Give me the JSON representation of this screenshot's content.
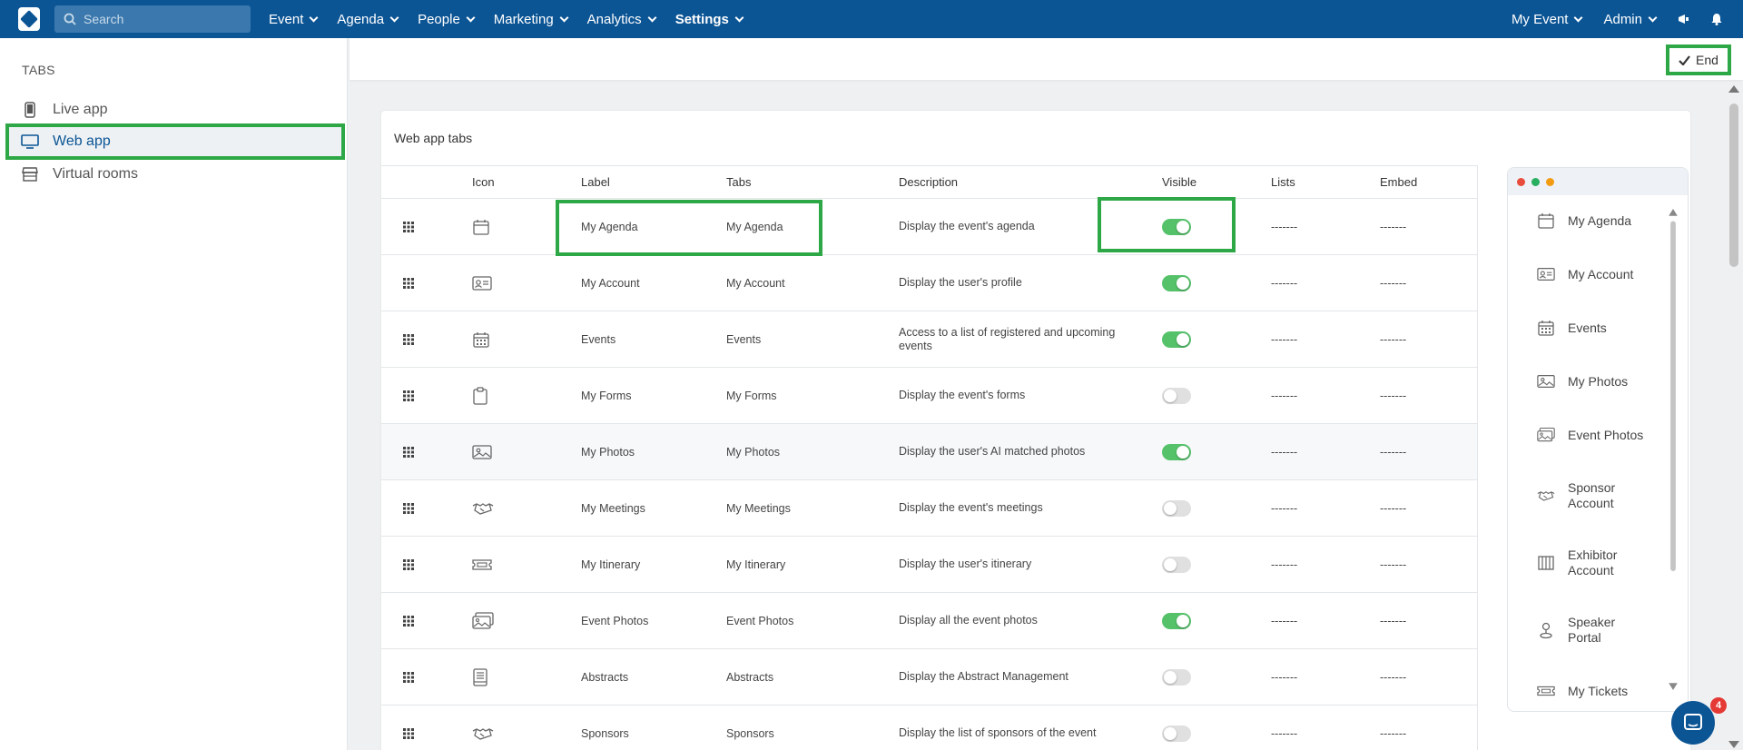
{
  "topbar": {
    "search_placeholder": "Search",
    "nav": [
      "Event",
      "Agenda",
      "People",
      "Marketing",
      "Analytics",
      "Settings"
    ],
    "right": [
      "My Event",
      "Admin"
    ],
    "brand_color": "#0c5595"
  },
  "sidebar": {
    "title": "TABS",
    "items": [
      {
        "label": "Live app",
        "icon": "mobile-icon"
      },
      {
        "label": "Web app",
        "icon": "monitor-icon"
      },
      {
        "label": "Virtual rooms",
        "icon": "store-icon"
      }
    ]
  },
  "header": {
    "end_label": "End"
  },
  "card": {
    "title": "Web app tabs",
    "columns": [
      "Icon",
      "Label",
      "Tabs",
      "Description",
      "Visible",
      "Lists",
      "Embed"
    ],
    "rows": [
      {
        "icon": "calendar-icon",
        "label": "My Agenda",
        "tabs": "My Agenda",
        "description": "Display the event's agenda",
        "visible": true,
        "lists": "-------",
        "embed": "-------"
      },
      {
        "icon": "id-card-icon",
        "label": "My Account",
        "tabs": "My Account",
        "description": "Display the user's profile",
        "visible": true,
        "lists": "-------",
        "embed": "-------"
      },
      {
        "icon": "calendar-grid-icon",
        "label": "Events",
        "tabs": "Events",
        "description": "Access to a list of registered and upcoming events",
        "visible": true,
        "lists": "-------",
        "embed": "-------"
      },
      {
        "icon": "clipboard-icon",
        "label": "My Forms",
        "tabs": "My Forms",
        "description": "Display the event's forms",
        "visible": false,
        "lists": "-------",
        "embed": "-------"
      },
      {
        "icon": "image-icon",
        "label": "My Photos",
        "tabs": "My Photos",
        "description": "Display the user's AI matched photos",
        "visible": true,
        "lists": "-------",
        "embed": "-------"
      },
      {
        "icon": "handshake-icon",
        "label": "My Meetings",
        "tabs": "My Meetings",
        "description": "Display the event's meetings",
        "visible": false,
        "lists": "-------",
        "embed": "-------"
      },
      {
        "icon": "ticket-icon",
        "label": "My Itinerary",
        "tabs": "My Itinerary",
        "description": "Display the user's itinerary",
        "visible": false,
        "lists": "-------",
        "embed": "-------"
      },
      {
        "icon": "images-icon",
        "label": "Event Photos",
        "tabs": "Event Photos",
        "description": "Display all the event photos",
        "visible": true,
        "lists": "-------",
        "embed": "-------"
      },
      {
        "icon": "book-icon",
        "label": "Abstracts",
        "tabs": "Abstracts",
        "description": "Display the Abstract Management",
        "visible": false,
        "lists": "-------",
        "embed": "-------"
      },
      {
        "icon": "handshake-icon",
        "label": "Sponsors",
        "tabs": "Sponsors",
        "description": "Display the list of sponsors of the event",
        "visible": false,
        "lists": "-------",
        "embed": "-------"
      }
    ]
  },
  "preview": {
    "items": [
      {
        "label": "My Agenda",
        "icon": "calendar-icon"
      },
      {
        "label": "My Account",
        "icon": "id-card-icon"
      },
      {
        "label": "Events",
        "icon": "calendar-grid-icon"
      },
      {
        "label": "My Photos",
        "icon": "image-icon"
      },
      {
        "label": "Event Photos",
        "icon": "images-icon"
      },
      {
        "label": "Sponsor Account",
        "line1": "Sponsor",
        "line2": "Account",
        "icon": "handshake-icon"
      },
      {
        "label": "Exhibitor Account",
        "line1": "Exhibitor",
        "line2": "Account",
        "icon": "booth-icon"
      },
      {
        "label": "Speaker Portal",
        "line1": "Speaker",
        "line2": "Portal",
        "icon": "speaker-icon"
      },
      {
        "label": "My Tickets",
        "icon": "ticket-icon"
      }
    ]
  },
  "chat": {
    "badge_count": "4"
  }
}
